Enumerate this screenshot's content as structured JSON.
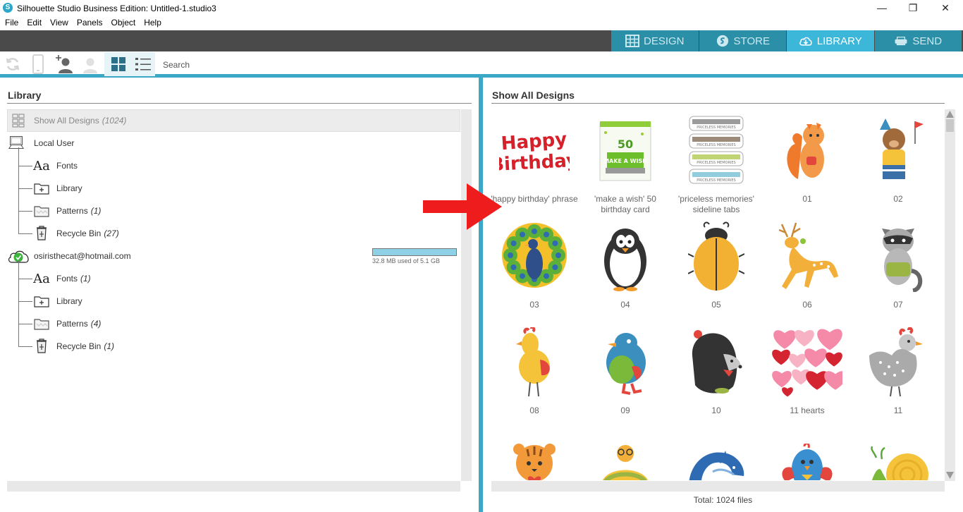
{
  "window": {
    "title": "Silhouette Studio Business Edition: Untitled-1.studio3",
    "app_icon": "S"
  },
  "menu": [
    "File",
    "Edit",
    "View",
    "Panels",
    "Object",
    "Help"
  ],
  "tabs": [
    {
      "label": "DESIGN",
      "icon": "grid-icon",
      "active": false
    },
    {
      "label": "STORE",
      "icon": "store-icon",
      "active": false
    },
    {
      "label": "LIBRARY",
      "icon": "cloud-icon",
      "active": true
    },
    {
      "label": "SEND",
      "icon": "cutter-icon",
      "active": false
    }
  ],
  "toolbar": {
    "search_label": "Search"
  },
  "library": {
    "title": "Library",
    "show_all": {
      "label": "Show All Designs",
      "count": "(1024)"
    },
    "local_user": {
      "label": "Local User",
      "items": [
        {
          "label": "Fonts",
          "count": ""
        },
        {
          "label": "Library",
          "count": ""
        },
        {
          "label": "Patterns",
          "count": "(1)"
        },
        {
          "label": "Recycle Bin",
          "count": "(27)"
        }
      ]
    },
    "cloud_user": {
      "label": "osiristhecat@hotmail.com",
      "storage": "32.8 MB used of 5.1 GB",
      "storage_used_fraction": 0.0063,
      "items": [
        {
          "label": "Fonts",
          "count": "(1)"
        },
        {
          "label": "Library",
          "count": ""
        },
        {
          "label": "Patterns",
          "count": "(4)"
        },
        {
          "label": "Recycle Bin",
          "count": "(1)"
        }
      ]
    }
  },
  "designs": {
    "title": "Show All Designs",
    "total": "Total: 1024 files",
    "items": [
      {
        "label": "'happy birthday' phrase",
        "thumb": "happy-birthday"
      },
      {
        "label": "'make a wish' 50 birthday card",
        "thumb": "make-a-wish",
        "text": "50",
        "text2": "MAKE A WISH"
      },
      {
        "label": "'priceless memories' sideline tabs",
        "thumb": "priceless",
        "text": "PRICELESS MEMORIES"
      },
      {
        "label": "01",
        "thumb": "squirrel"
      },
      {
        "label": "02",
        "thumb": "bear"
      },
      {
        "label": "03",
        "thumb": "peacock"
      },
      {
        "label": "04",
        "thumb": "penguin"
      },
      {
        "label": "05",
        "thumb": "beetle"
      },
      {
        "label": "06",
        "thumb": "deer"
      },
      {
        "label": "07",
        "thumb": "raccoon"
      },
      {
        "label": "08",
        "thumb": "chicken"
      },
      {
        "label": "09",
        "thumb": "bird"
      },
      {
        "label": "10",
        "thumb": "hedgehog"
      },
      {
        "label": "11 hearts",
        "thumb": "hearts"
      },
      {
        "label": "11",
        "thumb": "hen"
      },
      {
        "label": "",
        "thumb": "tiger"
      },
      {
        "label": "",
        "thumb": "turtle"
      },
      {
        "label": "",
        "thumb": "dolphin"
      },
      {
        "label": "",
        "thumb": "bluebird"
      },
      {
        "label": "",
        "thumb": "snail"
      }
    ]
  },
  "colors": {
    "accent": "#3cb6d9",
    "tab_inactive": "#2b8fa8",
    "topbar": "#4a4a4a",
    "arrow": "#ee1c1c"
  }
}
